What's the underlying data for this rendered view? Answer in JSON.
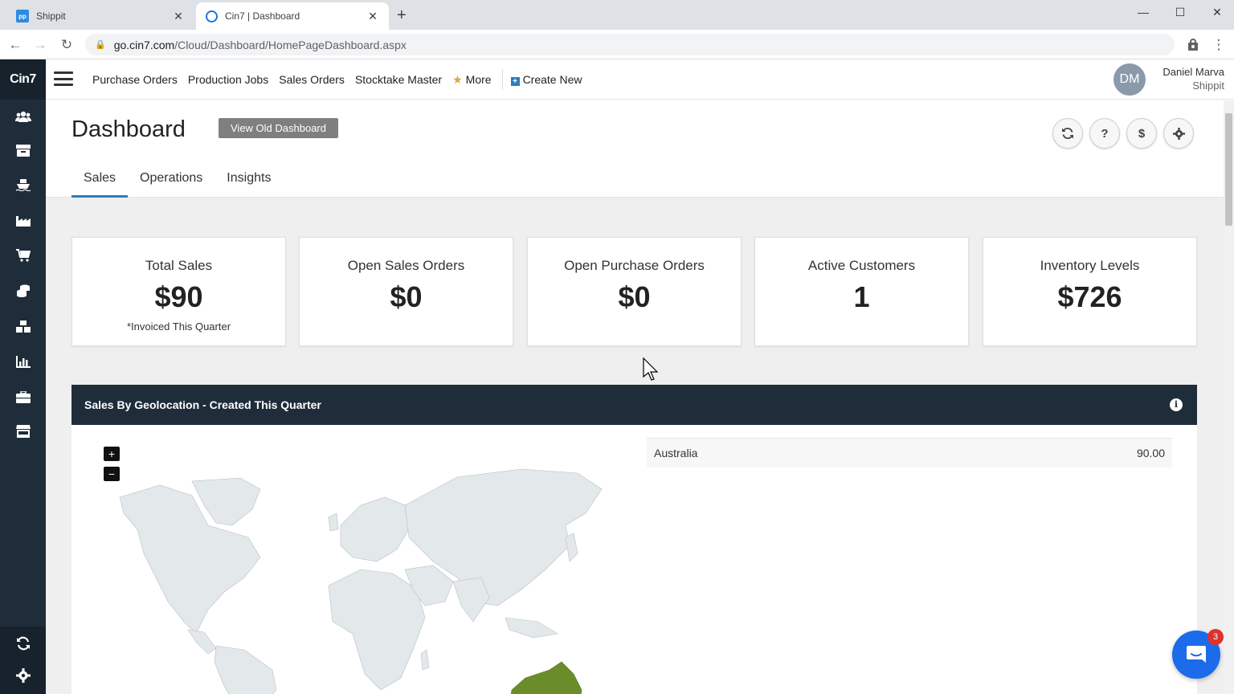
{
  "browser": {
    "tabs": [
      {
        "title": "Shippit",
        "favicon": "shippit-favicon"
      },
      {
        "title": "Cin7 | Dashboard",
        "favicon": "cin7-favicon"
      }
    ],
    "url_host": "go.cin7.com",
    "url_path": "/Cloud/Dashboard/HomePageDashboard.aspx"
  },
  "app": {
    "logo": "Cin7",
    "nav": {
      "links": [
        "Purchase Orders",
        "Production Jobs",
        "Sales Orders",
        "Stocktake Master"
      ],
      "more": "More",
      "create_new": "Create New"
    },
    "user": {
      "initials": "DM",
      "name": "Daniel Marva",
      "company": "Shippit"
    }
  },
  "dashboard": {
    "title": "Dashboard",
    "view_old": "View Old Dashboard",
    "tabs": [
      "Sales",
      "Operations",
      "Insights"
    ],
    "active_tab": "Sales",
    "kpis": [
      {
        "label": "Total Sales",
        "value": "$90",
        "note": "*Invoiced This Quarter"
      },
      {
        "label": "Open Sales Orders",
        "value": "$0",
        "note": ""
      },
      {
        "label": "Open Purchase Orders",
        "value": "$0",
        "note": ""
      },
      {
        "label": "Active Customers",
        "value": "1",
        "note": ""
      },
      {
        "label": "Inventory Levels",
        "value": "$726",
        "note": ""
      }
    ],
    "geo_panel": {
      "title": "Sales By Geolocation - Created This Quarter",
      "rows": [
        {
          "country": "Australia",
          "value": "90.00"
        }
      ],
      "highlight_color": "#6a8d2a"
    }
  },
  "chat_badge": "3",
  "colors": {
    "sidebar": "#1f2d3a",
    "accent": "#2c7dbd",
    "map_land": "#e3e8ea"
  }
}
